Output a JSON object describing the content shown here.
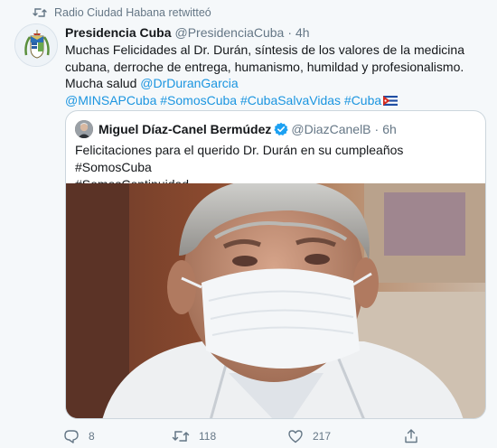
{
  "retweet_context": {
    "text": "Radio Ciudad Habana retwitteó",
    "icon": "retweet-icon"
  },
  "tweet": {
    "author_name": "Presidencia Cuba",
    "author_handle": "@PresidenciaCuba",
    "separator": "·",
    "time": "4h",
    "text_part1": "Muchas Felicidades al Dr. Durán, síntesis de los valores de la medicina cubana, derroche de entrega, humanismo, humildad y profesionalismo. Mucha salud ",
    "mention1": "@DrDuranGarcia",
    "mention2": "@MINSAPCuba",
    "hashtag1": "#SomosCuba",
    "hashtag2": "#CubaSalvaVidas",
    "hashtag3": "#Cuba",
    "flag_icon": "cuba-flag-icon"
  },
  "quoted_tweet": {
    "author_name": "Miguel Díaz-Canel Bermúdez",
    "author_handle": "@DiazCanelB",
    "separator": "·",
    "time": "6h",
    "text_line1": "Felicitaciones para el querido Dr.  Durán en su cumpleaños #SomosCuba",
    "text_line2": "#SomosContinuidad",
    "verified_icon": "verified-badge-icon"
  },
  "actions": {
    "reply_count": "8",
    "retweet_count": "118",
    "like_count": "217"
  },
  "colors": {
    "link": "#1b95e0",
    "muted": "#657786",
    "text": "#14171a",
    "background": "#f5f8fa",
    "border": "#ccd6dd"
  }
}
